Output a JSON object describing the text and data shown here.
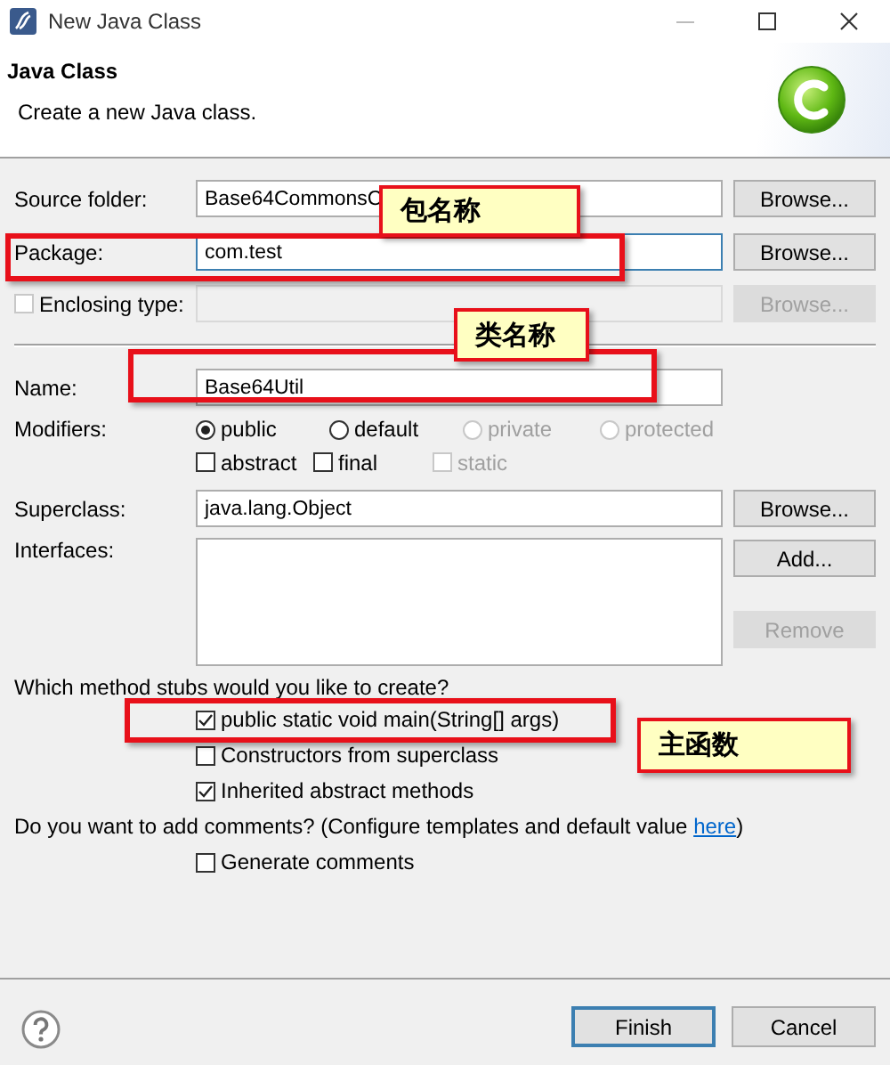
{
  "window": {
    "title": "New Java Class"
  },
  "header": {
    "title": "Java Class",
    "description": "Create a new Java class."
  },
  "location_fields": [
    {
      "kind": "text",
      "label": "Source folder:",
      "value": "Base64CommonsC",
      "focused": false,
      "disabled": false,
      "button": {
        "label": "Browse...",
        "disabled": false
      }
    },
    {
      "kind": "text",
      "label": "Package:",
      "value": "com.test",
      "focused": true,
      "disabled": false,
      "button": {
        "label": "Browse...",
        "disabled": false
      }
    },
    {
      "kind": "check",
      "label": "Enclosing type:",
      "checked": false,
      "focused": false,
      "disabled": true,
      "button": {
        "label": "Browse...",
        "disabled": true
      }
    }
  ],
  "name_field": {
    "label": "Name:",
    "value": "Base64Util"
  },
  "modifiers": {
    "label": "Modifiers:",
    "radios": [
      {
        "label": "public",
        "selected": true,
        "disabled": false
      },
      {
        "label": "default",
        "selected": false,
        "disabled": false
      },
      {
        "label": "private",
        "selected": false,
        "disabled": true
      },
      {
        "label": "protected",
        "selected": false,
        "disabled": true
      }
    ],
    "checkboxes": [
      {
        "label": "abstract",
        "checked": false,
        "disabled": false
      },
      {
        "label": "final",
        "checked": false,
        "disabled": false
      },
      {
        "label": "static",
        "checked": false,
        "disabled": true
      }
    ]
  },
  "superclass": {
    "label": "Superclass:",
    "value": "java.lang.Object",
    "button": {
      "label": "Browse...",
      "disabled": false
    }
  },
  "interfaces": {
    "label": "Interfaces:",
    "buttons": [
      {
        "label": "Add...",
        "disabled": false
      },
      {
        "label": "Remove",
        "disabled": true
      }
    ]
  },
  "stubs": {
    "question": "Which method stubs would you like to create?",
    "options": [
      {
        "label": "public static void main(String[] args)",
        "checked": true
      },
      {
        "label": "Constructors from superclass",
        "checked": false
      },
      {
        "label": "Inherited abstract methods",
        "checked": true
      }
    ]
  },
  "comments": {
    "text": "Do you want to add comments? (Configure templates and default value ",
    "link": "here",
    "text_after": ")",
    "option": {
      "label": "Generate comments",
      "checked": false
    }
  },
  "footer": {
    "buttons": [
      {
        "label": "Finish",
        "default": true
      },
      {
        "label": "Cancel",
        "default": false
      }
    ]
  },
  "annotations": [
    {
      "text": "包名称"
    },
    {
      "text": "类名称"
    },
    {
      "text": "主函数"
    }
  ]
}
